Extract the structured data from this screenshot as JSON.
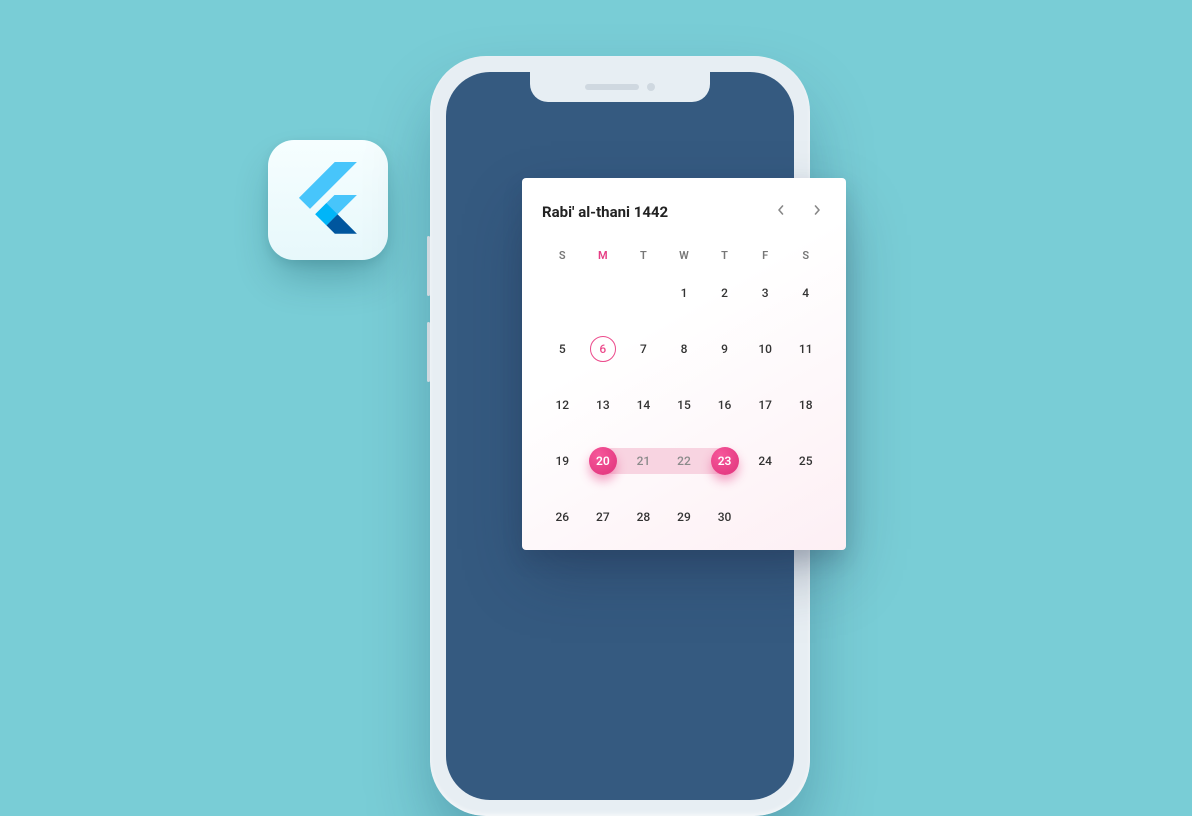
{
  "calendar": {
    "title": "Rabi' al-thani 1442",
    "weekdays": [
      "S",
      "M",
      "T",
      "W",
      "T",
      "F",
      "S"
    ],
    "accent_weekday_index": 1,
    "days_in_month": 30,
    "first_day_col": 3,
    "today": 6,
    "range": {
      "start": 20,
      "end": 23
    },
    "colors": {
      "accent": "#e63d84",
      "range_fill": "#f8d4e1"
    }
  },
  "flutter_logo": {
    "name": "flutter-logo-icon"
  }
}
